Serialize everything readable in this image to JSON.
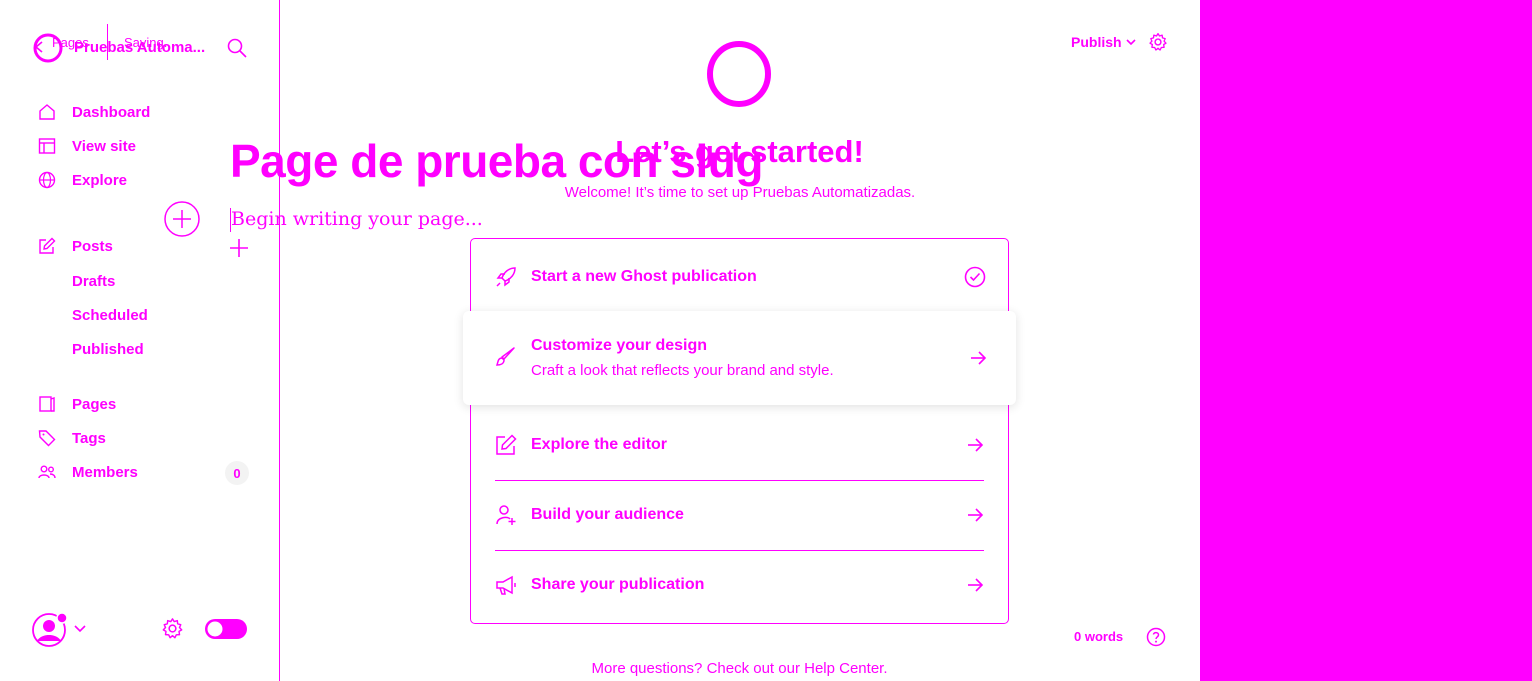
{
  "sidebar": {
    "breadcrumb_pages": "Pages",
    "breadcrumb_status": "Saving...",
    "site_name": "Pruebas Automa...",
    "items": [
      {
        "label": "Dashboard"
      },
      {
        "label": "View site"
      },
      {
        "label": "Explore"
      },
      {
        "label": "Posts"
      },
      {
        "label": "Pages"
      },
      {
        "label": "Tags"
      },
      {
        "label": "Members"
      }
    ],
    "post_subitems": [
      {
        "label": "Drafts"
      },
      {
        "label": "Scheduled"
      },
      {
        "label": "Published"
      }
    ],
    "members_count": "0"
  },
  "editor": {
    "title": "Page de prueba con slug",
    "body_placeholder": "Begin writing your page...",
    "word_count": "0 words"
  },
  "header": {
    "publish_label": "Publish"
  },
  "onboarding": {
    "heading": "Let’s get started!",
    "subheading": "Welcome! It’s time to set up Pruebas Automatizadas.",
    "steps": [
      {
        "title": "Start a new Ghost publication",
        "icon": "rocket-icon"
      },
      {
        "title": "Customize your design",
        "desc": "Craft a look that reflects your brand and style.",
        "icon": "paintbrush-icon"
      },
      {
        "title": "Explore the editor",
        "icon": "edit-icon"
      },
      {
        "title": "Build your audience",
        "icon": "add-user-icon"
      },
      {
        "title": "Share your publication",
        "icon": "megaphone-icon"
      }
    ],
    "footer_text": "More questions? Check out our Help Center."
  },
  "colors": {
    "accent": "#ff00ff",
    "background": "#ffffff"
  }
}
